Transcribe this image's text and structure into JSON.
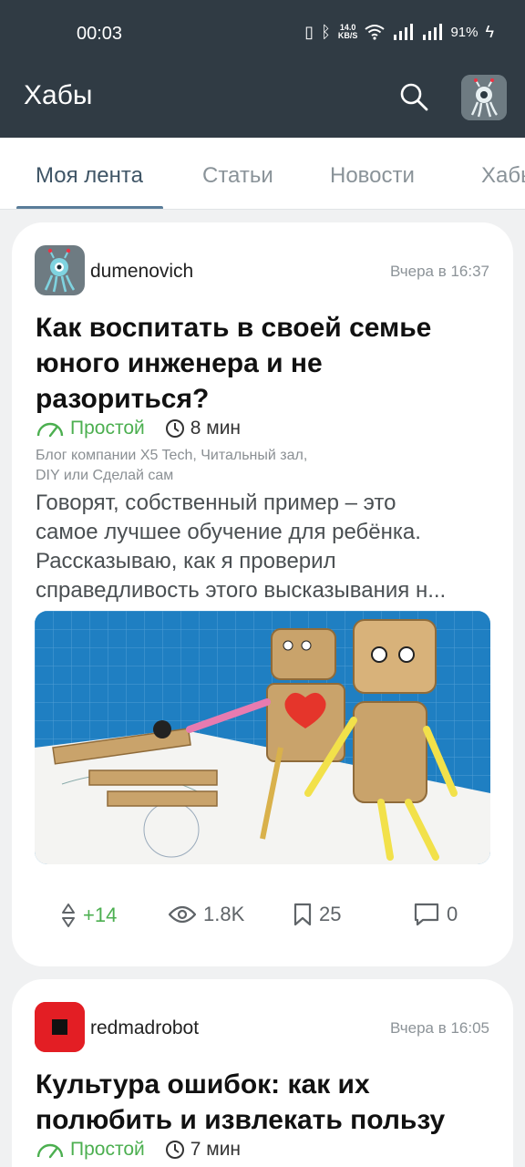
{
  "status_bar": {
    "time": "00:03",
    "speed_value": "14.0",
    "speed_unit": "KB/S",
    "battery": "91%"
  },
  "app_bar": {
    "title": "Хабы"
  },
  "tabs": [
    {
      "label": "Моя лента",
      "active": true
    },
    {
      "label": "Статьи",
      "active": false
    },
    {
      "label": "Новости",
      "active": false
    },
    {
      "label": "Хабы",
      "active": false
    }
  ],
  "posts": [
    {
      "author": "dumenovich",
      "date": "Вчера в 16:37",
      "title": "Как воспитать в своей семье юного инженера и не разориться?",
      "level": "Простой",
      "read_time": "8 мин",
      "hubs_line1": "Блог компании X5 Tech, Читальный зал,",
      "hubs_line2": "DIY или Сделай сам",
      "excerpt_lines": [
        "Говорят, собственный пример – это",
        "самое лучшее обучение для ребёнка.",
        "Рассказываю, как я проверил",
        "справедливость этого высказывания н..."
      ],
      "votes": "+14",
      "views": "1.8K",
      "bookmarks": "25",
      "comments": "0"
    },
    {
      "author": "redmadrobot",
      "date": "Вчера в 16:05",
      "title": "Культура ошибок: как их полюбить и извлекать пользу",
      "level": "Простой",
      "read_time": "7 мин"
    }
  ],
  "colors": {
    "topbar": "#303b44",
    "accent_green": "#4caf50",
    "tab_active": "#3f5566",
    "brand_red": "#e31e24"
  }
}
